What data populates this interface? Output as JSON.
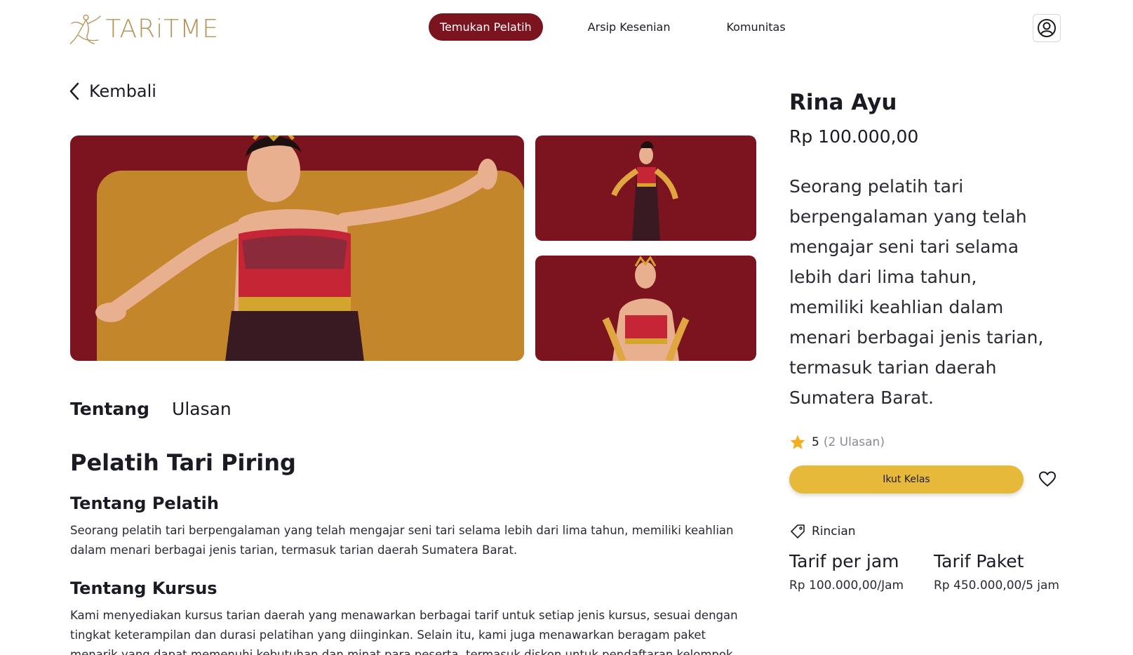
{
  "brand": {
    "name": "TARiTME",
    "accent": "#7c1420",
    "gold": "#b79358"
  },
  "nav": {
    "items": [
      {
        "label": "Temukan Pelatih",
        "active": true
      },
      {
        "label": "Arsip Kesenian",
        "active": false
      },
      {
        "label": "Komunitas",
        "active": false
      }
    ],
    "profile_icon": "user-circle-icon"
  },
  "back": {
    "label": "Kembali",
    "icon": "chevron-left-icon"
  },
  "tabs": [
    {
      "label": "Tentang",
      "active": true
    },
    {
      "label": "Ulasan",
      "active": false
    }
  ],
  "about": {
    "title": "Pelatih Tari Piring",
    "trainer_heading": "Tentang Pelatih",
    "trainer_text": "Seorang pelatih tari berpengalaman yang telah mengajar seni tari selama lebih dari lima tahun, memiliki keahlian dalam menari berbagai jenis tarian, termasuk tarian daerah Sumatera Barat.",
    "course_heading": "Tentang Kursus",
    "course_text": "Kami menyediakan kursus tarian daerah yang menawarkan berbagai tarif untuk setiap jenis kursus, sesuai dengan tingkat keterampilan dan durasi pelatihan yang diinginkan. Selain itu, kami juga menawarkan beragam paket menarik yang dapat memenuhi kebutuhan dan minat para peserta, termasuk diskon untuk pendaftaran kelompok."
  },
  "trainer": {
    "name": "Rina Ayu",
    "price": "Rp 100.000,00",
    "description": "Seorang pelatih tari berpengalaman yang telah mengajar seni tari selama lebih dari lima tahun, memiliki keahlian dalam menari berbagai jenis tarian, termasuk tarian daerah Sumatera Barat.",
    "rating": "5",
    "review_count": "(2 Ulasan)",
    "join_label": "Ikut Kelas",
    "detail_label": "Rincian",
    "rates": [
      {
        "title": "Tarif per jam",
        "value": "Rp 100.000,00/Jam"
      },
      {
        "title": "Tarif Paket",
        "value": "Rp 450.000,00/5 jam"
      }
    ]
  }
}
